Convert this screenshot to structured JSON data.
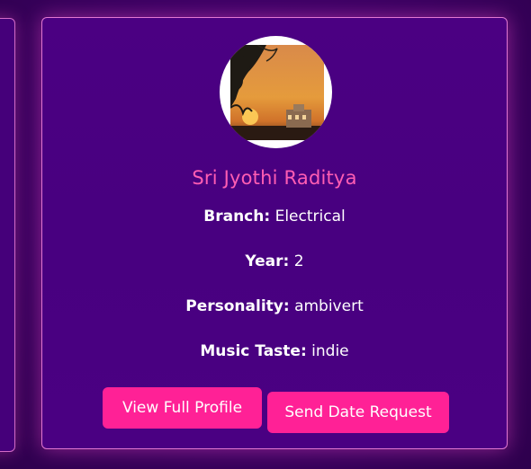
{
  "profile": {
    "name": "Sri Jyothi Raditya",
    "avatar_icon": "sunset-photo-avatar",
    "fields": [
      {
        "label": "Branch:",
        "value": "Electrical"
      },
      {
        "label": "Year:",
        "value": "2"
      },
      {
        "label": "Personality:",
        "value": "ambivert"
      },
      {
        "label": "Music Taste:",
        "value": "indie"
      }
    ]
  },
  "actions": {
    "view_profile": "View Full Profile",
    "send_request": "Send Date Request"
  },
  "colors": {
    "accent": "#ff2196",
    "name": "#ff5db3",
    "card_bg": "#4b0082",
    "border": "#e278d2"
  }
}
